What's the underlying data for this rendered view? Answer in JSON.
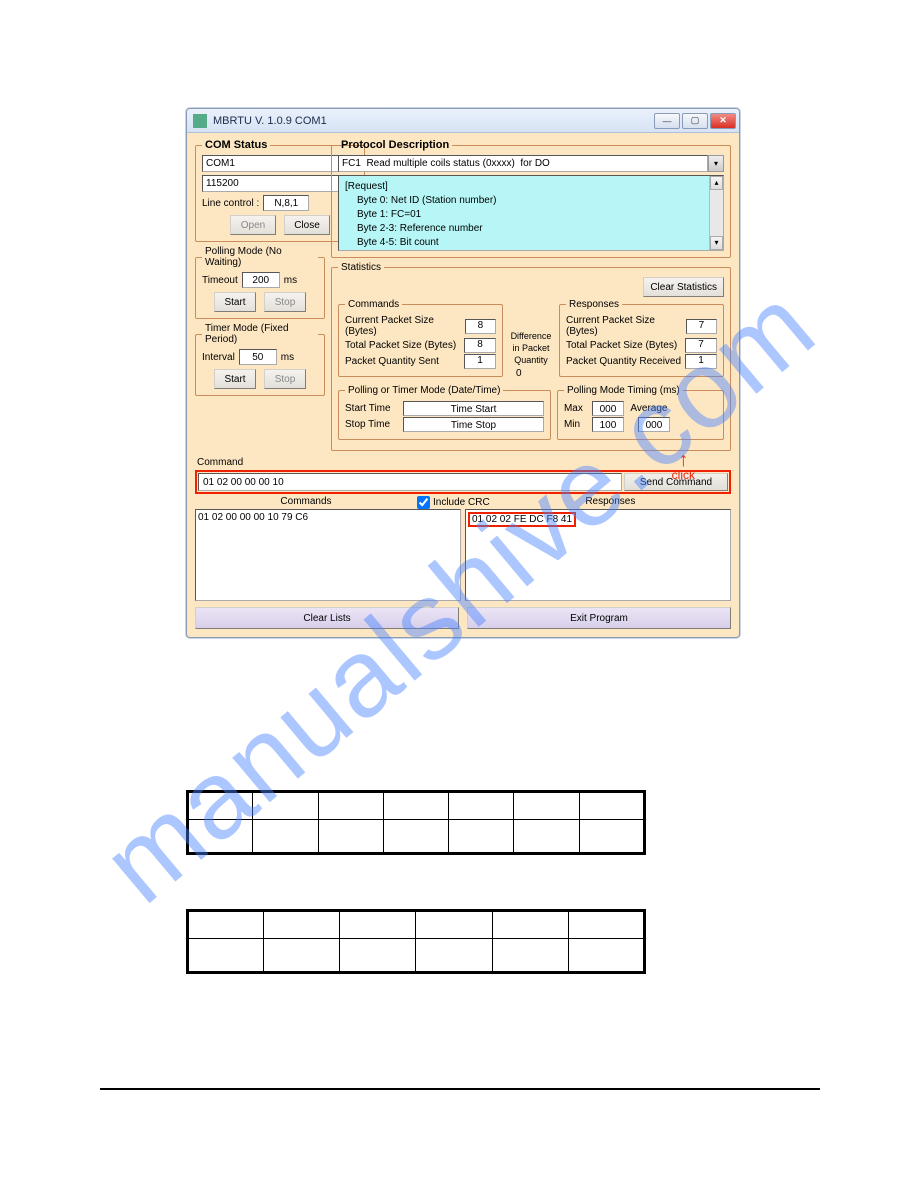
{
  "watermark": "manualshive.com",
  "window": {
    "title": "MBRTU V. 1.0.9  COM1"
  },
  "comStatus": {
    "legend": "COM Status",
    "port": "COM1",
    "baud": "115200",
    "lineControlLabel": "Line control :",
    "lineControl": "N,8,1",
    "openLabel": "Open",
    "closeLabel": "Close"
  },
  "pollingMode": {
    "legend": "Polling Mode (No Waiting)",
    "timeoutLabel": "Timeout",
    "timeoutValue": "200",
    "timeoutUnit": "ms",
    "startLabel": "Start",
    "stopLabel": "Stop"
  },
  "timerMode": {
    "legend": "Timer Mode (Fixed Period)",
    "intervalLabel": "Interval",
    "intervalValue": "50",
    "intervalUnit": "ms",
    "startLabel": "Start",
    "stopLabel": "Stop"
  },
  "protocol": {
    "legend": "Protocol Description",
    "selected": "FC1  Read multiple coils status (0xxxx)  for DO",
    "reqTitle": "[Request]",
    "l0": "Byte 0:     Net ID (Station number)",
    "l1": "Byte 1:     FC=01",
    "l2": "Byte 2-3:   Reference number",
    "l3": "Byte 4-5:   Bit count"
  },
  "statistics": {
    "legend": "Statistics",
    "clearLabel": "Clear Statistics",
    "commandsLegend": "Commands",
    "responsesLegend": "Responses",
    "cps": "Current Packet Size (Bytes)",
    "tps": "Total Packet Size (Bytes)",
    "pqs": "Packet Quantity Sent",
    "pqr": "Packet Quantity Received",
    "diffLabel1": "Difference",
    "diffLabel2": "in Packet",
    "diffLabel3": "Quantity",
    "cmd_cps": "8",
    "cmd_tps": "8",
    "cmd_pqs": "1",
    "diff": "0",
    "rsp_cps": "7",
    "rsp_tps": "7",
    "rsp_pqr": "1"
  },
  "timing": {
    "dtLegend": "Polling  or Timer Mode  (Date/Time)",
    "startTimeLabel": "Start Time",
    "stopTimeLabel": "Stop Time",
    "startVal": "Time Start",
    "stopVal": "Time Stop",
    "tmLegend": "Polling Mode Timing (ms)",
    "maxLabel": "Max",
    "maxVal": "000",
    "minLabel": "Min",
    "minVal": "100",
    "avgLabel": "Average",
    "avgVal": "000"
  },
  "command": {
    "label": "Command",
    "value": "01 02 00 00 00 10",
    "sendLabel": "Send Command"
  },
  "lists": {
    "commandsLabel": "Commands",
    "includeCRCLabel": "Include CRC",
    "responsesLabel": "Responses",
    "commandEntry": "01 02 00 00 00 10 79 C6",
    "responseEntry": "01 02 02 FE DC F8 41"
  },
  "bottom": {
    "clearLists": "Clear Lists",
    "exitProgram": "Exit Program"
  },
  "annotation": {
    "click": "click"
  }
}
